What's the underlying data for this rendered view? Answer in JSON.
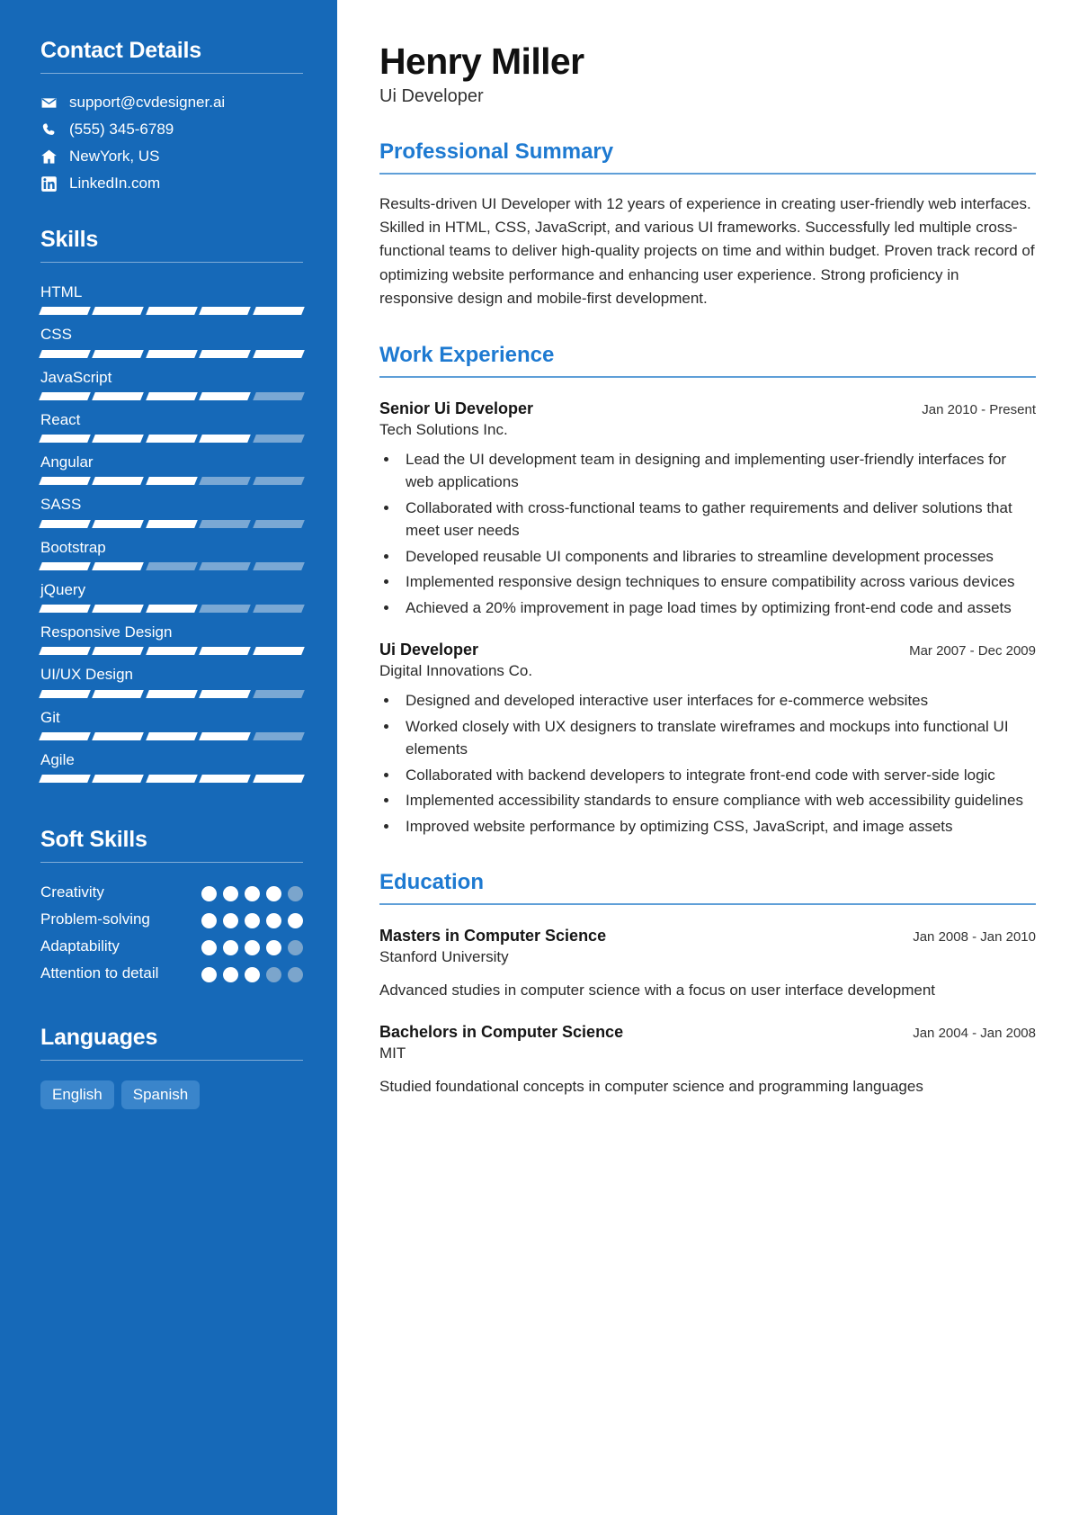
{
  "theme": {
    "sidebar_bg": "#1669b8",
    "accent": "#1e7ad1",
    "chip_bg": "#3a85cb",
    "bar_off": "#7aa8d4"
  },
  "sidebar": {
    "contact": {
      "heading": "Contact Details",
      "items": [
        {
          "icon": "envelope-icon",
          "value": "support@cvdesigner.ai"
        },
        {
          "icon": "phone-icon",
          "value": "(555) 345-6789"
        },
        {
          "icon": "home-icon",
          "value": "NewYork, US"
        },
        {
          "icon": "linkedin-icon",
          "value": "LinkedIn.com"
        }
      ]
    },
    "skills": {
      "heading": "Skills",
      "max": 5,
      "items": [
        {
          "name": "HTML",
          "level": 5
        },
        {
          "name": "CSS",
          "level": 5
        },
        {
          "name": "JavaScript",
          "level": 4
        },
        {
          "name": "React",
          "level": 4
        },
        {
          "name": "Angular",
          "level": 3
        },
        {
          "name": "SASS",
          "level": 3
        },
        {
          "name": "Bootstrap",
          "level": 2
        },
        {
          "name": "jQuery",
          "level": 3
        },
        {
          "name": "Responsive Design",
          "level": 5
        },
        {
          "name": "UI/UX Design",
          "level": 4
        },
        {
          "name": "Git",
          "level": 4
        },
        {
          "name": "Agile",
          "level": 5
        }
      ]
    },
    "soft_skills": {
      "heading": "Soft Skills",
      "max": 5,
      "items": [
        {
          "name": "Creativity",
          "level": 4
        },
        {
          "name": "Problem-solving",
          "level": 5
        },
        {
          "name": "Adaptability",
          "level": 4
        },
        {
          "name": "Attention to detail",
          "level": 3
        }
      ]
    },
    "languages": {
      "heading": "Languages",
      "items": [
        "English",
        "Spanish"
      ]
    }
  },
  "main": {
    "name": "Henry Miller",
    "role": "Ui Developer",
    "summary": {
      "heading": "Professional Summary",
      "text": "Results-driven UI Developer with 12 years of experience in creating user-friendly web interfaces. Skilled in HTML, CSS, JavaScript, and various UI frameworks. Successfully led multiple cross-functional teams to deliver high-quality projects on time and within budget. Proven track record of optimizing website performance and enhancing user experience. Strong proficiency in responsive design and mobile-first development."
    },
    "work": {
      "heading": "Work Experience",
      "entries": [
        {
          "title": "Senior Ui Developer",
          "date": "Jan 2010 - Present",
          "org": "Tech Solutions Inc.",
          "bullets": [
            "Lead the UI development team in designing and implementing user-friendly interfaces for web applications",
            "Collaborated with cross-functional teams to gather requirements and deliver solutions that meet user needs",
            "Developed reusable UI components and libraries to streamline development processes",
            "Implemented responsive design techniques to ensure compatibility across various devices",
            "Achieved a 20% improvement in page load times by optimizing front-end code and assets"
          ]
        },
        {
          "title": "Ui Developer",
          "date": "Mar 2007 - Dec 2009",
          "org": "Digital Innovations Co.",
          "bullets": [
            "Designed and developed interactive user interfaces for e-commerce websites",
            "Worked closely with UX designers to translate wireframes and mockups into functional UI elements",
            "Collaborated with backend developers to integrate front-end code with server-side logic",
            "Implemented accessibility standards to ensure compliance with web accessibility guidelines",
            "Improved website performance by optimizing CSS, JavaScript, and image assets"
          ]
        }
      ]
    },
    "education": {
      "heading": "Education",
      "entries": [
        {
          "title": "Masters in Computer Science",
          "date": "Jan 2008 - Jan 2010",
          "org": "Stanford University",
          "desc": "Advanced studies in computer science with a focus on user interface development"
        },
        {
          "title": "Bachelors in Computer Science",
          "date": "Jan 2004 - Jan 2008",
          "org": "MIT",
          "desc": "Studied foundational concepts in computer science and programming languages"
        }
      ]
    }
  }
}
